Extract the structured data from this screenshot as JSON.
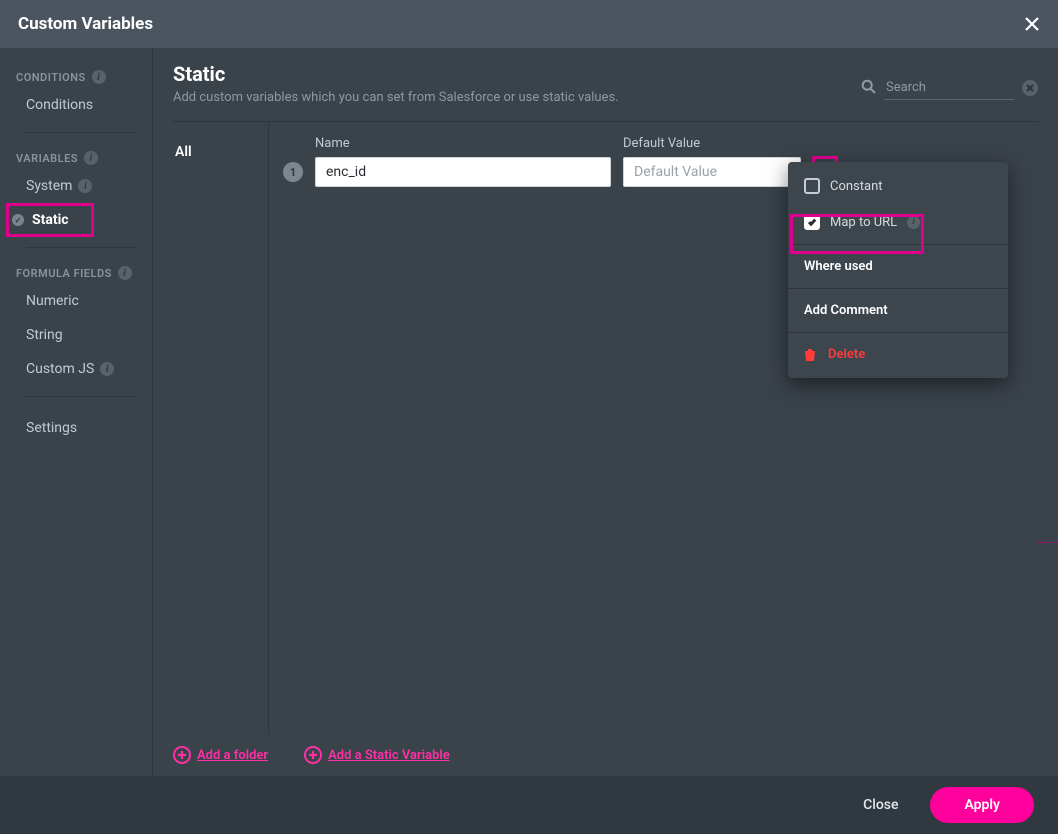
{
  "dialog": {
    "title": "Custom Variables"
  },
  "sidebar": {
    "groups": {
      "conditions": {
        "label": "CONDITIONS",
        "items": [
          {
            "label": "Conditions"
          }
        ]
      },
      "variables": {
        "label": "VARIABLES",
        "items": [
          {
            "label": "System"
          },
          {
            "label": "Static"
          }
        ]
      },
      "formula": {
        "label": "FORMULA FIELDS",
        "items": [
          {
            "label": "Numeric"
          },
          {
            "label": "String"
          },
          {
            "label": "Custom JS"
          }
        ]
      }
    },
    "settings": {
      "label": "Settings"
    }
  },
  "page": {
    "title": "Static",
    "subtitle": "Add custom variables which you can set from Salesforce or use static values."
  },
  "search": {
    "placeholder": "Search"
  },
  "folders": {
    "all": "All"
  },
  "columns": {
    "name": "Name",
    "default": "Default Value"
  },
  "row": {
    "num": "1",
    "name_value": "enc_id",
    "default_placeholder": "Default Value"
  },
  "menu": {
    "constant": "Constant",
    "map_to_url": "Map to URL",
    "where_used": "Where used",
    "add_comment": "Add Comment",
    "delete": "Delete"
  },
  "add": {
    "folder": "Add a folder",
    "variable": "Add a Static Variable"
  },
  "footer": {
    "close": "Close",
    "apply": "Apply"
  }
}
